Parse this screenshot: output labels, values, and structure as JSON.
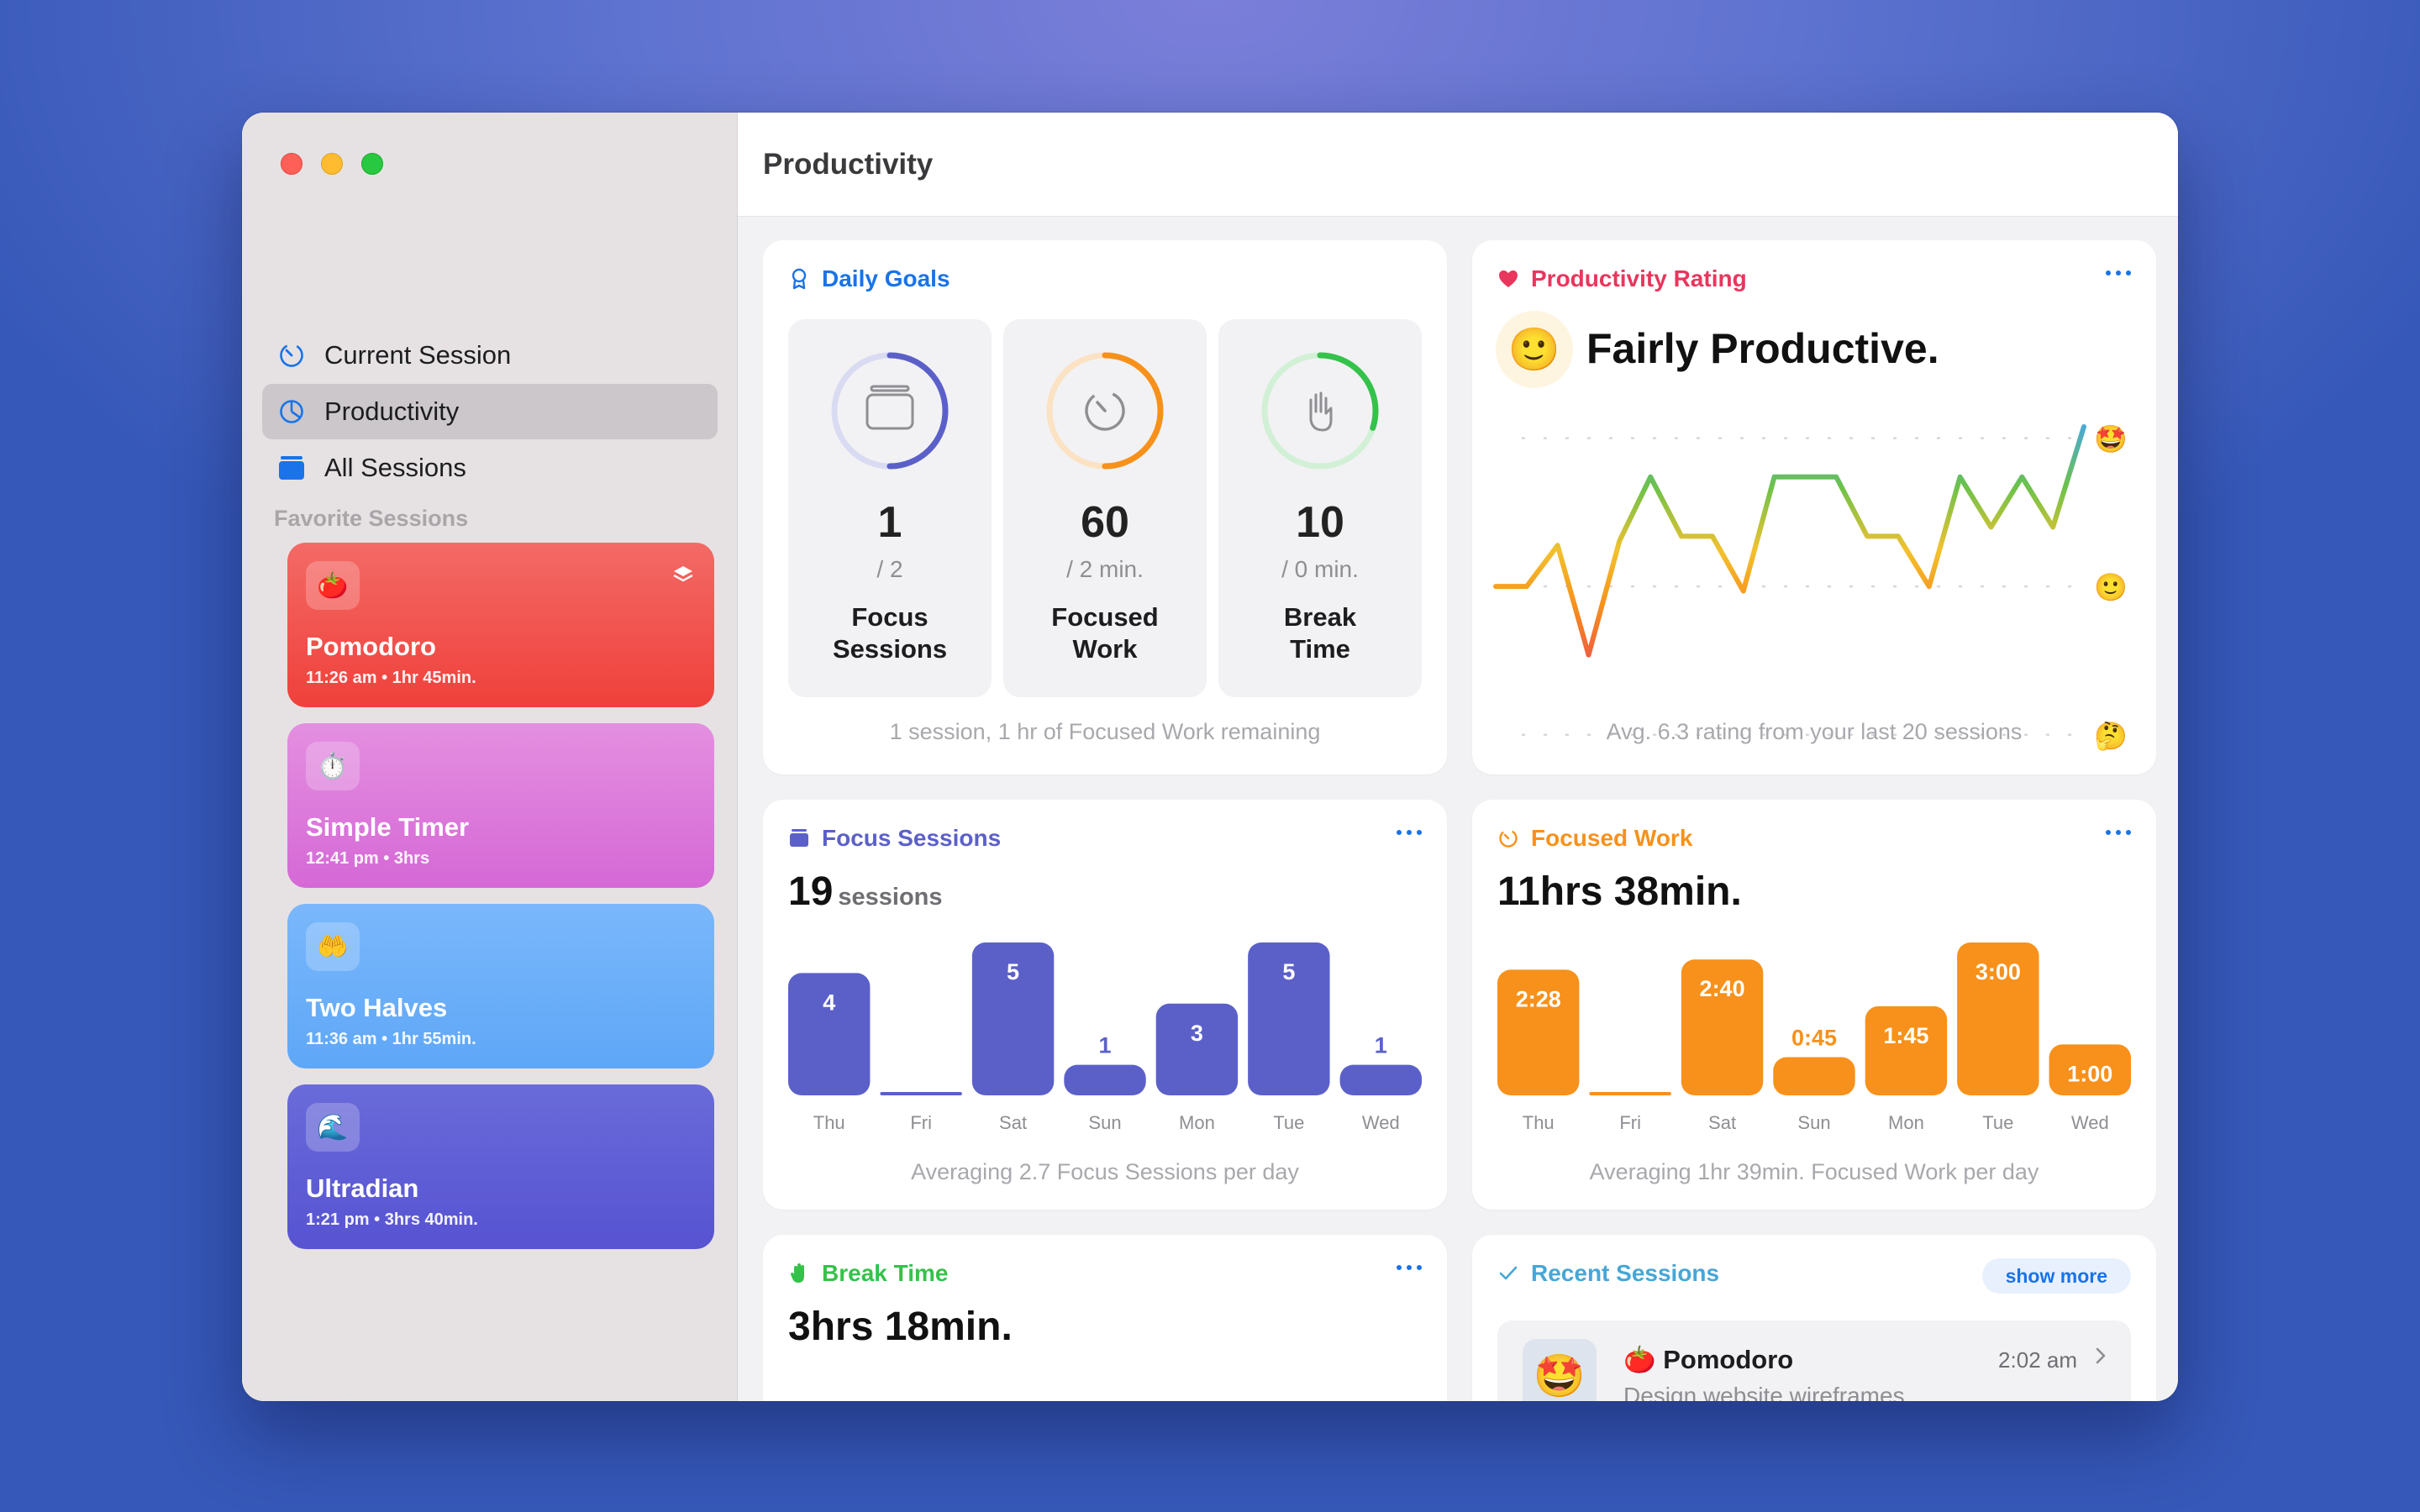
{
  "window": {
    "title": "Productivity"
  },
  "sidebar": {
    "items": [
      {
        "label": "Current Session",
        "icon": "timer-icon"
      },
      {
        "label": "Productivity",
        "icon": "pie-chart-icon",
        "active": true
      },
      {
        "label": "All Sessions",
        "icon": "stack-icon"
      }
    ],
    "favorites_header": "Favorite Sessions",
    "favorites": [
      {
        "title": "Pomodoro",
        "subtitle": "11:26 am • 1hr 45min.",
        "emoji": "🍅",
        "color": "#f0403b"
      },
      {
        "title": "Simple Timer",
        "subtitle": "12:41 pm • 3hrs",
        "emoji": "⏱️",
        "color": "#d568d6"
      },
      {
        "title": "Two Halves",
        "subtitle": "11:36 am • 1hr 55min.",
        "emoji": "🤲",
        "color": "#5ea7f7"
      },
      {
        "title": "Ultradian",
        "subtitle": "1:21 pm • 3hrs 40min.",
        "emoji": "🌊",
        "color": "#5753d2"
      }
    ]
  },
  "daily_goals": {
    "title": "Daily Goals",
    "goals": [
      {
        "value": "1",
        "target": "/ 2",
        "label_line1": "Focus",
        "label_line2": "Sessions",
        "progress": 0.5,
        "color": "#5b60c9"
      },
      {
        "value": "60",
        "target": "/ 2 min.",
        "label_line1": "Focused",
        "label_line2": "Work",
        "progress": 0.5,
        "color": "#f7911b"
      },
      {
        "value": "10",
        "target": "/ 0 min.",
        "label_line1": "Break",
        "label_line2": "Time",
        "progress": 0.3,
        "color": "#35c24a"
      }
    ],
    "footnote": "1 session, 1 hr of Focused Work remaining"
  },
  "productivity_rating": {
    "title": "Productivity Rating",
    "face": "🙂",
    "rating_text": "Fairly Productive.",
    "footnote": "Avg. 6.3 rating from your last 20 sessions",
    "axis_emojis": [
      "🤩",
      "🙂",
      "🤔"
    ],
    "color": "#e8365d"
  },
  "focus_sessions": {
    "title": "Focus Sessions",
    "total": "19",
    "unit": "sessions",
    "footnote": "Averaging 2.7 Focus Sessions per day",
    "color": "#5b60c9"
  },
  "focused_work": {
    "title": "Focused Work",
    "total": "11hrs 38min.",
    "footnote": "Averaging 1hr 39min. Focused Work per day",
    "color": "#f7911b"
  },
  "break_time": {
    "title": "Break Time",
    "total": "3hrs 18min.",
    "color": "#35c24a"
  },
  "recent_sessions": {
    "title": "Recent Sessions",
    "show_more": "show more",
    "items": [
      {
        "face": "🤩",
        "emoji": "🍅",
        "title": "Pomodoro",
        "desc": "Design website wireframes",
        "time": "2:02 am"
      }
    ]
  },
  "chart_data": [
    {
      "type": "line",
      "title": "Productivity Rating",
      "y_labels": [
        "🤩",
        "🙂",
        "🤔"
      ],
      "values": [
        5.0,
        5.0,
        6.8,
        2.0,
        7.0,
        9.8,
        7.2,
        7.2,
        4.8,
        9.8,
        9.8,
        9.8,
        7.2,
        7.2,
        5.0,
        9.8,
        7.6,
        9.8,
        7.6,
        12.0
      ],
      "ylim": [
        0,
        12
      ]
    },
    {
      "type": "bar",
      "title": "Focus Sessions",
      "categories": [
        "Thu",
        "Fri",
        "Sat",
        "Sun",
        "Mon",
        "Tue",
        "Wed"
      ],
      "values": [
        4,
        0,
        5,
        1,
        3,
        5,
        1
      ],
      "labels": [
        "4",
        "",
        "5",
        "1",
        "3",
        "5",
        "1"
      ],
      "ylim": [
        0,
        5
      ]
    },
    {
      "type": "bar",
      "title": "Focused Work",
      "categories": [
        "Thu",
        "Fri",
        "Sat",
        "Sun",
        "Mon",
        "Tue",
        "Wed"
      ],
      "values": [
        148,
        0,
        160,
        45,
        105,
        180,
        60
      ],
      "labels": [
        "2:28",
        "",
        "2:40",
        "0:45",
        "1:45",
        "3:00",
        "1:00"
      ],
      "ylim": [
        0,
        180
      ]
    }
  ]
}
